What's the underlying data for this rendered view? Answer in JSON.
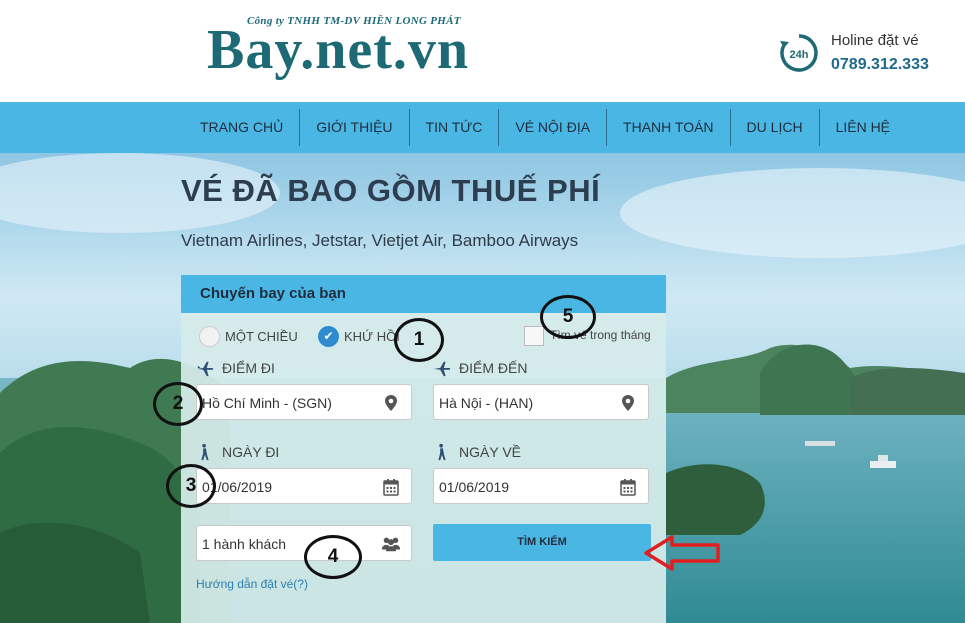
{
  "header": {
    "company": "Công ty TNHH TM-DV HIỀN LONG PHÁT",
    "logo": "Bay.net.vn",
    "hotline_label": "Holine đặt vé",
    "hotline_number": "0789.312.333",
    "hotline_badge": "24h",
    "hotline_icon": "phone-24h-icon"
  },
  "nav": {
    "items": [
      "TRANG CHỦ",
      "GIỚI THIỆU",
      "TIN TỨC",
      "VÉ NỘI ĐỊA",
      "THANH TOÁN",
      "DU LỊCH",
      "LIÊN HỆ"
    ]
  },
  "hero": {
    "title": "VÉ ĐÃ BAO GỒM THUẾ PHÍ",
    "subtitle": "Vietnam Airlines, Jetstar, Vietjet Air, Bamboo Airways"
  },
  "booking": {
    "header": "Chuyến bay của bạn",
    "trip_types": [
      {
        "label": "MỘT CHIỀU",
        "selected": false
      },
      {
        "label": "KHỨ HỒI",
        "selected": true
      }
    ],
    "monthly_search_label": "Tìm vé trong tháng",
    "monthly_search_checked": false,
    "from_label": "ĐIỂM ĐI",
    "from_value": "Hồ Chí Minh - (SGN)",
    "to_label": "ĐIỂM ĐẾN",
    "to_value": "Hà Nội - (HAN)",
    "depart_label": "NGÀY ĐI",
    "depart_value": "01/06/2019",
    "return_label": "NGÀY VỀ",
    "return_value": "01/06/2019",
    "passengers": "1  hành khách",
    "search_button": "TÌM KIẾM",
    "help_link": "Hướng dẫn đặt vé(?)"
  },
  "annotations": [
    "1",
    "2",
    "3",
    "4",
    "5"
  ],
  "colors": {
    "accent": "#4ab6e3",
    "logo": "#1e6a74",
    "title": "#2d3e50",
    "arrow": "#e02020"
  }
}
